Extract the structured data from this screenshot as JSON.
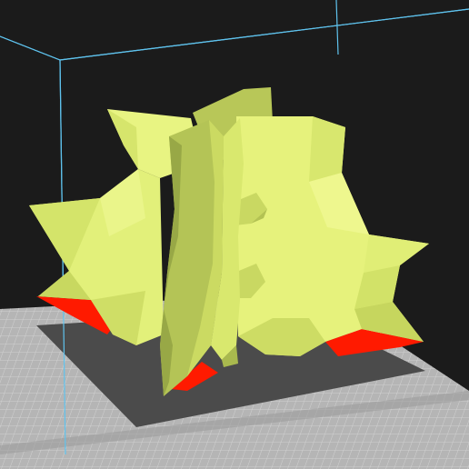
{
  "viewport": {
    "background_color": "#1b1b1b",
    "build_volume_color": "#5fc3ee",
    "bed_color": "#b8b8b8",
    "bed_grid_color": "#d6d6d6",
    "bed_shadow_color": "#4a4a4a"
  },
  "model": {
    "body_color": "#e6f27a",
    "body_shade_color": "#c8d860",
    "body_dark_color": "#9fae48",
    "overhang_color": "#ff0a00"
  }
}
